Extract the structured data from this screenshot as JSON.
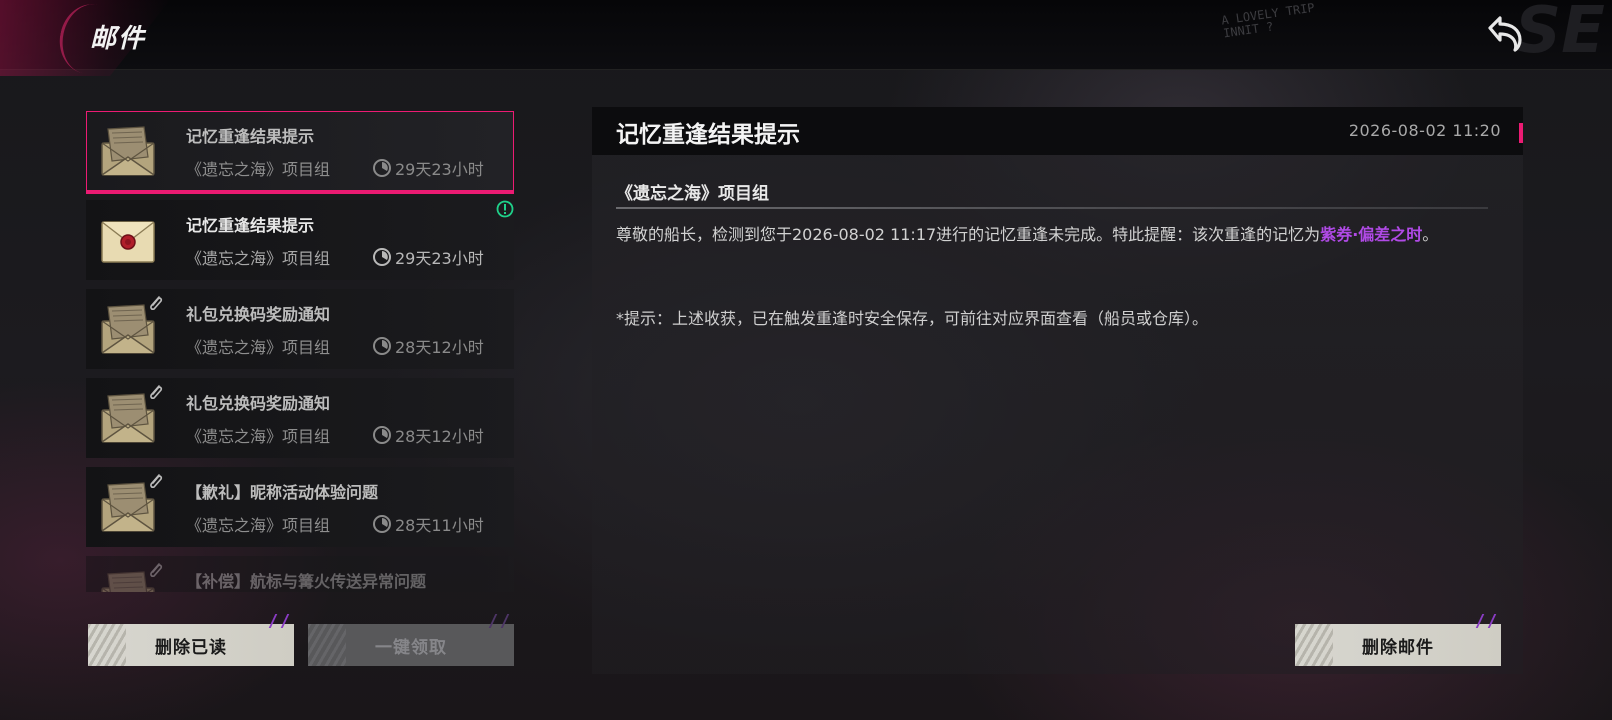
{
  "header": {
    "title": "邮件",
    "deco_text": "A LOVELY TRIP\nINNIT ?",
    "deco_big": "SE",
    "back_icon": "back-arrow-icon"
  },
  "mail_list": [
    {
      "title": "记忆重逢结果提示",
      "sender": "《遗忘之海》项目组",
      "expire": "29天23小时",
      "icon": "envelope-open-icon",
      "state": "read",
      "selected": true,
      "attachment": false
    },
    {
      "title": "记忆重逢结果提示",
      "sender": "《遗忘之海》项目组",
      "expire": "29天23小时",
      "icon": "envelope-sealed-icon",
      "state": "unread",
      "selected": false,
      "attachment": false,
      "alert": true
    },
    {
      "title": "礼包兑换码奖励通知",
      "sender": "《遗忘之海》项目组",
      "expire": "28天12小时",
      "icon": "envelope-open-icon",
      "state": "read",
      "attachment": true
    },
    {
      "title": "礼包兑换码奖励通知",
      "sender": "《遗忘之海》项目组",
      "expire": "28天12小时",
      "icon": "envelope-open-icon",
      "state": "read",
      "attachment": true
    },
    {
      "title": "【歉礼】昵称活动体验问题",
      "sender": "《遗忘之海》项目组",
      "expire": "28天11小时",
      "icon": "envelope-open-icon",
      "state": "read",
      "attachment": true
    },
    {
      "title": "【补偿】航标与篝火传送异常问题",
      "sender": "",
      "expire": "",
      "icon": "envelope-open-icon",
      "state": "read",
      "attachment": true
    }
  ],
  "buttons": {
    "delete_read": "删除已读",
    "claim_all": "一键领取",
    "delete_mail": "删除邮件"
  },
  "detail": {
    "title": "记忆重逢结果提示",
    "date": "2026-08-02 11:20",
    "sender": "《遗忘之海》项目组",
    "body_prefix": "尊敬的船长，检测到您于2026-08-02 11:17进行的记忆重逢未完成。特此提醒：该次重逢的记忆为",
    "body_highlight": "紫券·偏差之时",
    "body_suffix": "。",
    "note": "*提示：上述收获，已在触发重逢时安全保存，可前往对应界面查看（船员或仓库）。"
  },
  "colors": {
    "accent_pink": "#ec1b73",
    "highlight_purple": "#b04ae6",
    "alert_green": "#1fd18a"
  }
}
